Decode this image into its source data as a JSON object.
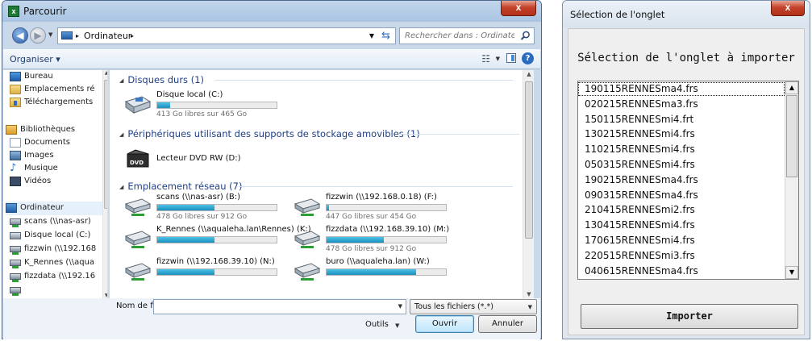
{
  "file_dialog": {
    "title": "Parcourir",
    "app_icon_letter": "x",
    "close_label": "x",
    "address": {
      "crumb": "Ordinateur",
      "separator": "▸",
      "search_placeholder": "Rechercher dans : Ordinateur"
    },
    "toolbar": {
      "organise_label": "Organiser ▾"
    },
    "sidebar": {
      "items": [
        {
          "label": "Bureau",
          "icon": "desktop-icon"
        },
        {
          "label": "Emplacements ré",
          "icon": "folder-icon"
        },
        {
          "label": "Téléchargements",
          "icon": "downloads-icon"
        },
        {
          "label": "Bibliothèques",
          "icon": "library-icon"
        },
        {
          "label": "Documents",
          "icon": "document-icon"
        },
        {
          "label": "Images",
          "icon": "image-icon"
        },
        {
          "label": "Musique",
          "icon": "music-icon"
        },
        {
          "label": "Vidéos",
          "icon": "video-icon"
        },
        {
          "label": "Ordinateur",
          "icon": "computer-icon"
        },
        {
          "label": "scans (\\\\nas-asr)",
          "icon": "network-drive-icon"
        },
        {
          "label": "Disque local (C:)",
          "icon": "local-disk-icon"
        },
        {
          "label": "fizzwin (\\\\192.168",
          "icon": "network-drive-icon"
        },
        {
          "label": "K_Rennes (\\\\aqua",
          "icon": "network-drive-icon"
        },
        {
          "label": "fizzdata (\\\\192.16",
          "icon": "network-drive-icon"
        },
        {
          "label": "",
          "icon": "network-drive-icon"
        }
      ]
    },
    "groups": {
      "hard_disks": "Disques durs (1)",
      "removable": "Périphériques utilisant des supports de stockage amovibles (1)",
      "network": "Emplacement réseau (7)"
    },
    "drives": {
      "local": {
        "name": "Disque local (C:)",
        "free": "413 Go libres sur 465 Go",
        "used_fraction": 0.11
      },
      "dvd": {
        "name": "Lecteur DVD RW (D:)"
      },
      "network": [
        {
          "name": "scans (\\\\nas-asr) (B:)",
          "free": "478 Go libres sur 912 Go",
          "used_fraction": 0.48
        },
        {
          "name": "fizzwin (\\\\192.168.0.18) (F:)",
          "free": "447 Go libres sur 454 Go",
          "used_fraction": 0.02
        },
        {
          "name": "K_Rennes (\\\\aqualeha.lan\\Rennes) (K:)",
          "free": "",
          "used_fraction": 0.48
        },
        {
          "name": "fizzdata (\\\\192.168.39.10) (M:)",
          "free": "478 Go libres sur 912 Go",
          "used_fraction": 0.48
        },
        {
          "name": "fizzwin (\\\\192.168.39.10) (N:)",
          "free": "",
          "used_fraction": 0.48
        },
        {
          "name": "buro (\\\\aqualeha.lan) (W:)",
          "free": "",
          "used_fraction": 0.75
        }
      ]
    },
    "bottom": {
      "filename_label": "Nom de fichier :",
      "filename_value": "",
      "filter_value": "Tous les fichiers (*.*)",
      "tools_label": "Outils",
      "open_label": "Ouvrir",
      "cancel_label": "Annuler"
    }
  },
  "tab_dialog": {
    "title": "Sélection de l'onglet",
    "close_label": "x",
    "heading": "Sélection de l'onglet à importer",
    "tabs": [
      "190115RENNESma4.frs",
      "020215RENNESma3.frs",
      "150115RENNESmi4.frt",
      "130215RENNESmi4.frs",
      "110215RENNESmi4.frs",
      "050315RENNESmi4.frs",
      "190215RENNESma4.frs",
      "090315RENNESma4.frs",
      "210415RENNESmi2.frs",
      "130415RENNESmi4.frs",
      "170615RENNESmi4.frs",
      "220515RENNESmi3.frs",
      "040615RENNESma4.frs"
    ],
    "selected_index": 0,
    "import_label": "Importer"
  }
}
